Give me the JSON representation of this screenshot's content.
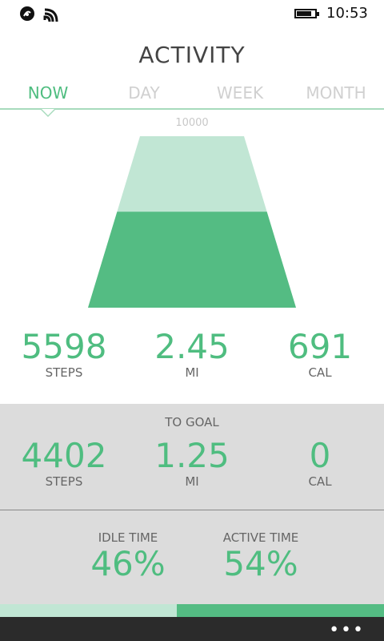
{
  "status": {
    "time": "10:53"
  },
  "app": {
    "title": "ACTIVITY"
  },
  "tabs": [
    {
      "label": "NOW",
      "active": true
    },
    {
      "label": "DAY",
      "active": false
    },
    {
      "label": "WEEK",
      "active": false
    },
    {
      "label": "MONTH",
      "active": false
    }
  ],
  "chart_data": {
    "type": "bar",
    "goal_label": "10000",
    "goal": 10000,
    "value": 5598,
    "colors": {
      "goal": "#c1e6d4",
      "progress": "#54bc83"
    }
  },
  "current": {
    "steps": {
      "value": "5598",
      "unit": "STEPS"
    },
    "distance": {
      "value": "2.45",
      "unit": "MI"
    },
    "calories": {
      "value": "691",
      "unit": "CAL"
    }
  },
  "to_goal": {
    "label": "TO GOAL",
    "steps": {
      "value": "4402",
      "unit": "STEPS"
    },
    "distance": {
      "value": "1.25",
      "unit": "MI"
    },
    "calories": {
      "value": "0",
      "unit": "CAL"
    }
  },
  "time_split": {
    "idle": {
      "label": "IDLE TIME",
      "value": "46%",
      "fraction": 0.46
    },
    "active": {
      "label": "ACTIVE TIME",
      "value": "54%",
      "fraction": 0.54
    }
  },
  "app_bar": {
    "more": "•••"
  },
  "colors": {
    "accent": "#4fbd80",
    "light_accent": "#c1e6d4",
    "panel": "#dcdcdc",
    "app_bar": "#2b2b2b"
  }
}
